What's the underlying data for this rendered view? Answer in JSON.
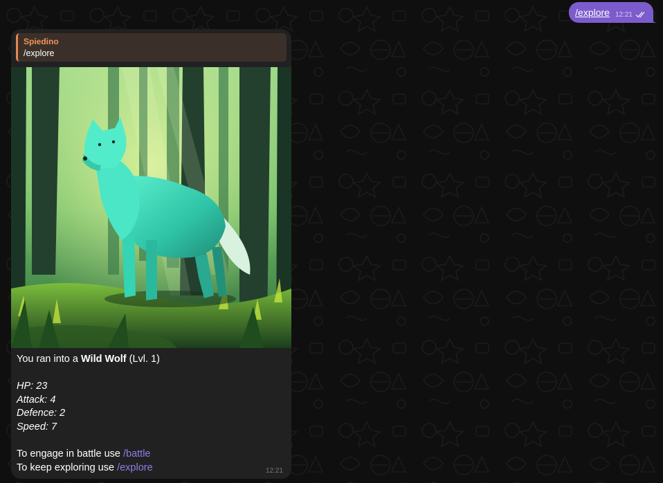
{
  "colors": {
    "background": "#0f0f0f",
    "outgoing_bubble": "#7c5ccc",
    "incoming_bubble": "#212121",
    "reply_accent": "#e3894f",
    "link": "#8f7fe6"
  },
  "outgoing_message": {
    "text": "/explore",
    "time": "12:21",
    "status_icon": "double-check-icon"
  },
  "incoming_message": {
    "reply": {
      "sender": "Spiedino",
      "text": "/explore"
    },
    "image": {
      "icon": "wolf-in-forest-illustration"
    },
    "encounter": {
      "prefix": "You ran into a ",
      "monster": "Wild Wolf",
      "level": " (Lvl. 1)"
    },
    "stats": [
      "HP: 23",
      "Attack: 4",
      "Defence: 2",
      "Speed: 7"
    ],
    "instructions": [
      {
        "text": "To engage in battle use ",
        "command": "/battle"
      },
      {
        "text": "To keep exploring use ",
        "command": "/explore"
      }
    ],
    "time": "12:21"
  }
}
